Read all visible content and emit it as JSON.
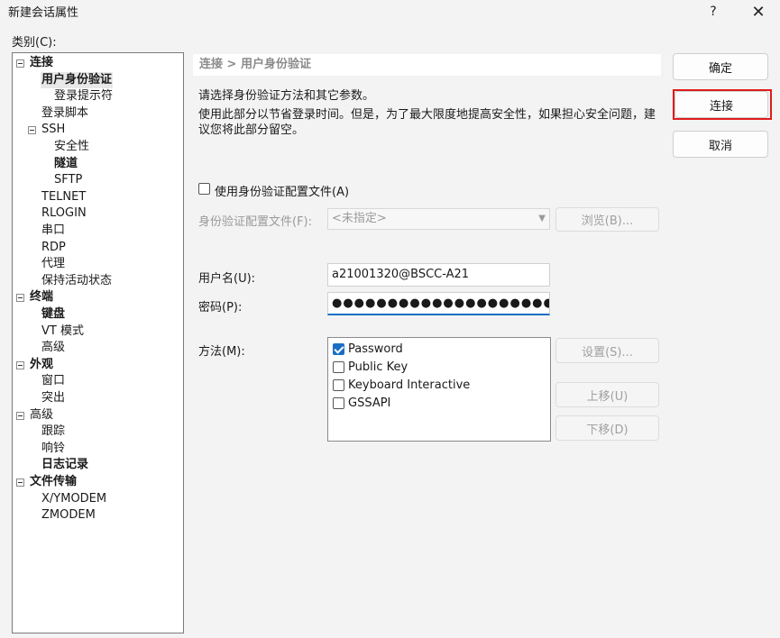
{
  "window": {
    "title": "新建会话属性",
    "help_label": "?",
    "close_label": "✕"
  },
  "category_label": "类别(C):",
  "tree": [
    {
      "label": "连接",
      "bold": true,
      "toggle": true
    },
    {
      "label": "用户身份验证",
      "bold": true,
      "selected": true
    },
    {
      "label": "登录提示符"
    },
    {
      "label": "登录脚本"
    },
    {
      "label": "SSH",
      "toggle": true
    },
    {
      "label": "安全性"
    },
    {
      "label": "隧道",
      "bold": true
    },
    {
      "label": "SFTP"
    },
    {
      "label": "TELNET"
    },
    {
      "label": "RLOGIN"
    },
    {
      "label": "串口"
    },
    {
      "label": "RDP"
    },
    {
      "label": "代理"
    },
    {
      "label": "保持活动状态"
    },
    {
      "label": "终端",
      "bold": true,
      "toggle": true
    },
    {
      "label": "键盘",
      "bold": true
    },
    {
      "label": "VT 模式"
    },
    {
      "label": "高级"
    },
    {
      "label": "外观",
      "bold": true,
      "toggle": true
    },
    {
      "label": "窗口"
    },
    {
      "label": "突出"
    },
    {
      "label": "高级",
      "toggle": true
    },
    {
      "label": "跟踪"
    },
    {
      "label": "响铃"
    },
    {
      "label": "日志记录",
      "bold": true
    },
    {
      "label": "文件传输",
      "bold": true,
      "toggle": true
    },
    {
      "label": "X/YMODEM"
    },
    {
      "label": "ZMODEM"
    }
  ],
  "main": {
    "breadcrumb": "连接 > 用户身份验证",
    "description1": "请选择身份验证方法和其它参数。",
    "description2": "使用此部分以节省登录时间。但是，为了最大限度地提高安全性，如果担心安全问题，建议您将此部分留空。",
    "use_profile_label": "使用身份验证配置文件(A)",
    "use_profile_checked": false,
    "profile_label": "身份验证配置文件(F):",
    "profile_value": "<未指定>",
    "browse_label": "浏览(B)...",
    "username_label": "用户名(U):",
    "username_value": "a21001320@BSCC-A21",
    "password_label": "密码(P):",
    "password_value": "●●●●●●●●●●●●●●●●●●●●●●●●●●●●●",
    "method_label": "方法(M):",
    "methods": [
      {
        "label": "Password",
        "checked": true
      },
      {
        "label": "Public Key",
        "checked": false
      },
      {
        "label": "Keyboard Interactive",
        "checked": false
      },
      {
        "label": "GSSAPI",
        "checked": false
      }
    ],
    "settings_label": "设置(S)...",
    "move_up_label": "上移(U)",
    "move_down_label": "下移(D)"
  },
  "buttons": {
    "ok_label": "确定",
    "connect_label": "连接",
    "cancel_label": "取消"
  },
  "colors": {
    "highlight": "#e01b1b",
    "accent": "#1a6fc4"
  }
}
